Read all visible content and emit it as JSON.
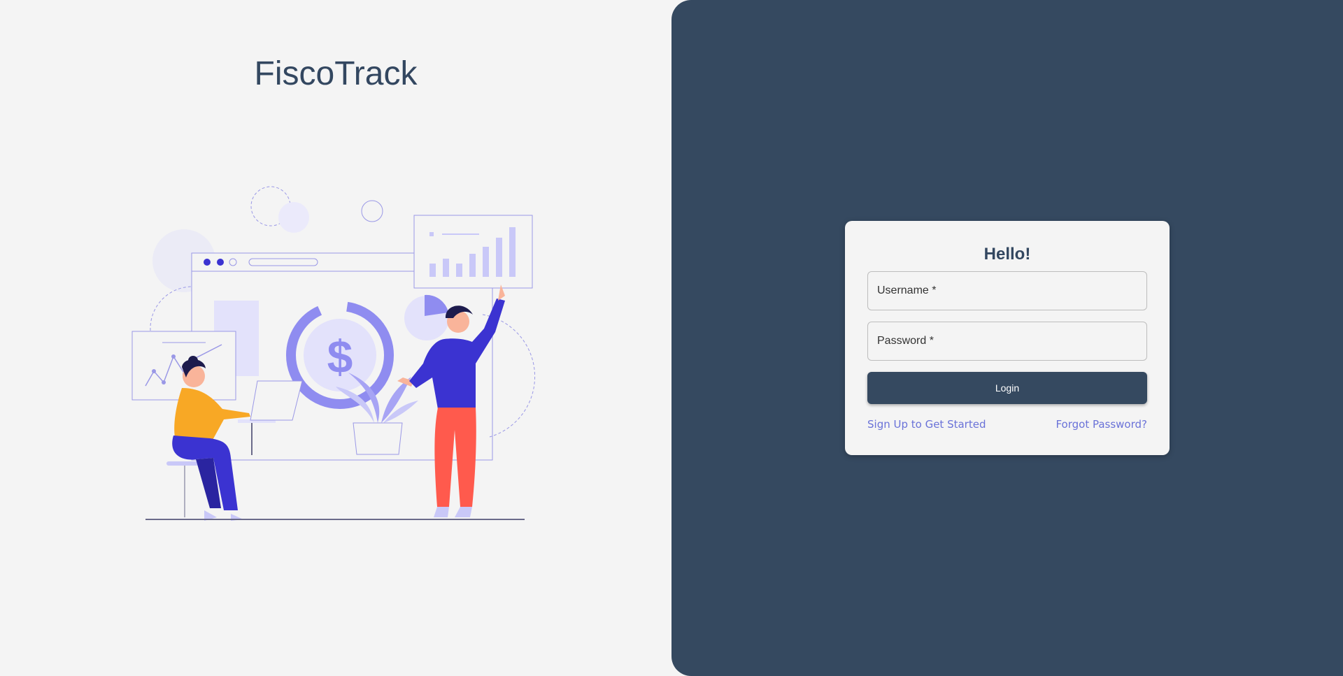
{
  "app": {
    "title": "FiscoTrack"
  },
  "login": {
    "greeting": "Hello!",
    "username_label": "Username *",
    "password_label": "Password *",
    "login_button": "Login",
    "signup_link": "Sign Up to Get Started",
    "forgot_link": "Forgot Password?"
  },
  "colors": {
    "brand_dark": "#354960",
    "background": "#f4f4f4",
    "link": "#6a72d8",
    "illustration_primary": "#3b33d1",
    "illustration_light": "#c9c8f8",
    "illustration_accent_yellow": "#f8a825",
    "illustration_accent_red": "#ff5a4d"
  },
  "illustration": {
    "icon": "finance-team-illustration",
    "currency_symbol": "$"
  }
}
